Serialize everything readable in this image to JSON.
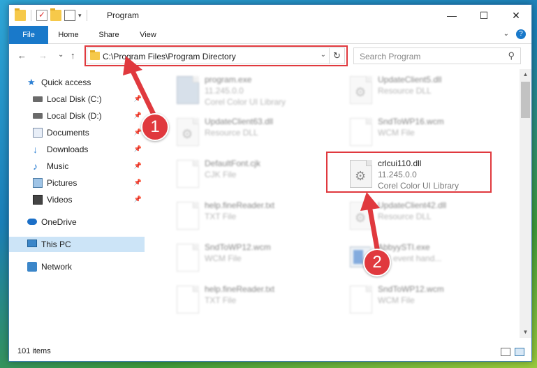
{
  "window": {
    "title": "Program",
    "buttons": {
      "minimize": "—",
      "maximize": "☐",
      "close": "✕"
    }
  },
  "ribbon": {
    "tabs": [
      {
        "label": "File"
      },
      {
        "label": "Home"
      },
      {
        "label": "Share"
      },
      {
        "label": "View"
      }
    ],
    "help": "?"
  },
  "navbar": {
    "back": "←",
    "forward": "→",
    "recent": "⌄",
    "up": "↑",
    "address": "C:\\Program Files\\Program Directory",
    "refresh": "↻",
    "search_placeholder": "Search Program"
  },
  "sidebar": {
    "items": [
      {
        "label": "Quick access",
        "pinned": false
      },
      {
        "label": "Local Disk (C:)",
        "pinned": true
      },
      {
        "label": "Local Disk (D:)",
        "pinned": true
      },
      {
        "label": "Documents",
        "pinned": true
      },
      {
        "label": "Downloads",
        "pinned": true
      },
      {
        "label": "Music",
        "pinned": true
      },
      {
        "label": "Pictures",
        "pinned": true
      },
      {
        "label": "Videos",
        "pinned": true
      },
      {
        "label": "OneDrive",
        "pinned": false
      },
      {
        "label": "This PC",
        "pinned": false,
        "selected": true
      },
      {
        "label": "Network",
        "pinned": false
      }
    ],
    "pin_glyph": "📌"
  },
  "files": [
    {
      "name": "program.exe",
      "sub1": "11.245.0.0",
      "sub2": "Corel Color UI Library",
      "icon": "exe-icon"
    },
    {
      "name": "UpdateClient5.dll",
      "sub1": "Resource DLL",
      "sub2": "",
      "icon": "dll-gear-icon"
    },
    {
      "name": "UpdateClient63.dll",
      "sub1": "Resource DLL",
      "sub2": "",
      "icon": "dll-gear-icon"
    },
    {
      "name": "SndToWP16.wcm",
      "sub1": "WCM File",
      "sub2": "",
      "icon": "blank-file-icon"
    },
    {
      "name": "DefaultFont.cjk",
      "sub1": "CJK File",
      "sub2": "",
      "icon": "blank-file-icon"
    },
    {
      "name": "crlcui110.dll",
      "sub1": "11.245.0.0",
      "sub2": "Corel Color UI Library",
      "icon": "dll-gear-icon"
    },
    {
      "name": "help.fineReader.txt",
      "sub1": "TXT File",
      "sub2": "",
      "icon": "blank-file-icon"
    },
    {
      "name": "UpdateClient42.dll",
      "sub1": "Resource DLL",
      "sub2": "",
      "icon": "dll-gear-icon"
    },
    {
      "name": "SndToWP12.wcm",
      "sub1": "WCM File",
      "sub2": "",
      "icon": "blank-file-icon"
    },
    {
      "name": "AbbyySTI.exe",
      "sub1": "STI event hand...",
      "sub2": "",
      "icon": "app-icon"
    },
    {
      "name": "help.fineReader.txt",
      "sub1": "TXT File",
      "sub2": "",
      "icon": "blank-file-icon"
    },
    {
      "name": "SndToWP12.wcm",
      "sub1": "WCM File",
      "sub2": "",
      "icon": "blank-file-icon"
    }
  ],
  "status": {
    "item_count": "101 items"
  },
  "annotations": {
    "step1": "1",
    "step2": "2",
    "color": "#e0393e"
  }
}
